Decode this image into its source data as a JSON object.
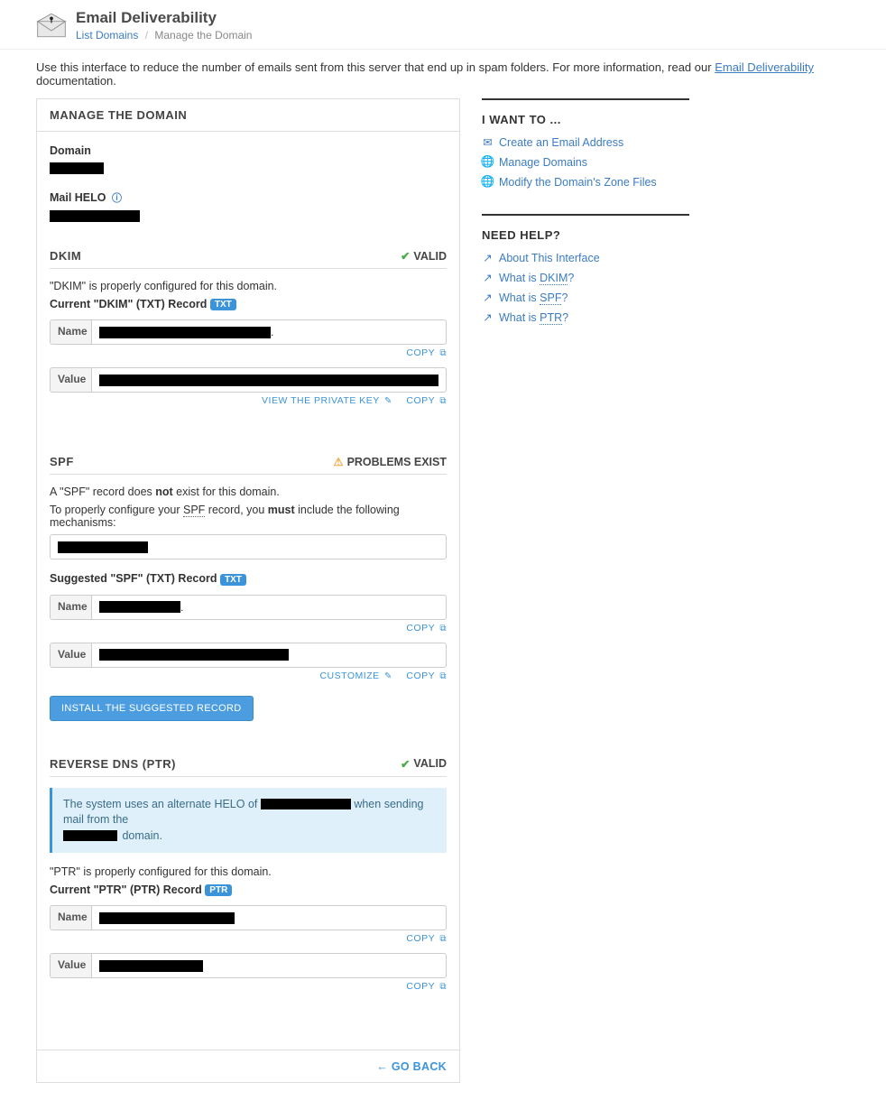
{
  "header": {
    "title": "Email Deliverability",
    "breadcrumb": {
      "link": "List Domains",
      "current": "Manage the Domain"
    }
  },
  "intro": {
    "pre": "Use this interface to reduce the number of emails sent from this server that end up in spam folders. For more information, read our ",
    "link": "Email Deliverability",
    "post": " documentation."
  },
  "panel": {
    "title": "MANAGE THE DOMAIN",
    "domain_label": "Domain",
    "helo_label": "Mail HELO",
    "dkim": {
      "title": "DKIM",
      "status": "VALID",
      "desc": "\"DKIM\" is properly configured for this domain.",
      "record_label": "Current \"DKIM\" (TXT) Record",
      "badge": "TXT",
      "name_label": "Name",
      "value_label": "Value",
      "copy": "COPY",
      "view_key": "VIEW THE PRIVATE KEY"
    },
    "spf": {
      "title": "SPF",
      "status": "PROBLEMS EXIST",
      "desc_pre": "A \"SPF\" record does ",
      "desc_bold": "not",
      "desc_post": " exist for this domain.",
      "mech_pre": "To properly configure your ",
      "mech_abbr": "SPF",
      "mech_mid": " record, you ",
      "mech_bold": "must",
      "mech_post": " include the following mechanisms:",
      "suggested_label": "Suggested \"SPF\" (TXT) Record",
      "badge": "TXT",
      "name_label": "Name",
      "value_label": "Value",
      "copy": "COPY",
      "customize": "CUSTOMIZE",
      "install_btn": "INSTALL THE SUGGESTED RECORD"
    },
    "ptr": {
      "title": "REVERSE DNS (PTR)",
      "status": "VALID",
      "info_pre": "The system uses an alternate HELO of ",
      "info_mid": " when sending mail from the ",
      "info_post": " domain.",
      "desc": "\"PTR\" is properly configured for this domain.",
      "record_label": "Current \"PTR\" (PTR) Record",
      "badge": "PTR",
      "name_label": "Name",
      "value_label": "Value",
      "copy": "COPY"
    },
    "go_back": "GO BACK"
  },
  "sidebar": {
    "want": {
      "title": "I WANT TO ...",
      "items": [
        "Create an Email Address",
        "Manage Domains",
        "Modify the Domain's Zone Files"
      ]
    },
    "help": {
      "title": "NEED HELP?",
      "items": [
        {
          "text": "About This Interface"
        },
        {
          "pre": "What is ",
          "abbr": "DKIM",
          "post": "?"
        },
        {
          "pre": "What is ",
          "abbr": "SPF",
          "post": "?"
        },
        {
          "pre": "What is ",
          "abbr": "PTR",
          "post": "?"
        }
      ]
    }
  }
}
